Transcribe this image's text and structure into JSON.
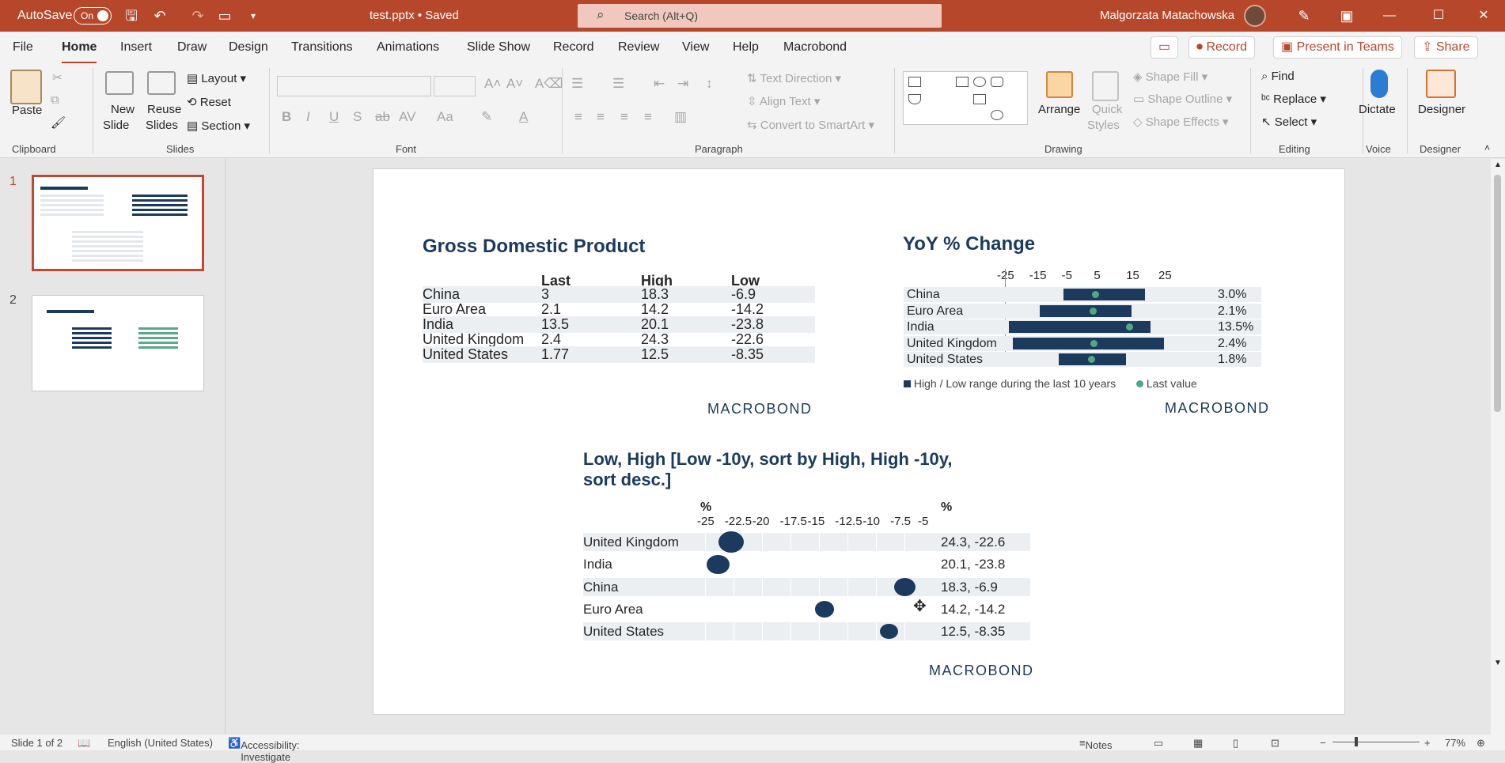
{
  "titlebar": {
    "autosave_label": "AutoSave",
    "toggle_label": "On",
    "doc_title": "test.pptx • Saved",
    "search_placeholder": "Search (Alt+Q)",
    "user_name": "Malgorzata Matachowska",
    "accent_color": "#b7472a"
  },
  "menu": {
    "items": [
      "File",
      "Home",
      "Insert",
      "Draw",
      "Design",
      "Transitions",
      "Animations",
      "Slide Show",
      "Record",
      "Review",
      "View",
      "Help",
      "Macrobond"
    ],
    "active": "Home",
    "record_button": "Record",
    "present_button": "Present in Teams",
    "share_button": "Share"
  },
  "ribbon": {
    "clipboard": {
      "paste": "Paste",
      "group": "Clipboard"
    },
    "slides": {
      "new_slide_1": "New",
      "new_slide_2": "Slide",
      "reuse_1": "Reuse",
      "reuse_2": "Slides",
      "layout": "Layout",
      "reset": "Reset",
      "section": "Section",
      "group": "Slides"
    },
    "font": {
      "group": "Font"
    },
    "paragraph": {
      "text_direction": "Text Direction",
      "align_text": "Align Text",
      "convert_smartart": "Convert to SmartArt",
      "group": "Paragraph"
    },
    "drawing": {
      "arrange": "Arrange",
      "quick_1": "Quick",
      "quick_2": "Styles",
      "shape_fill": "Shape Fill",
      "shape_outline": "Shape Outline",
      "shape_effects": "Shape Effects",
      "group": "Drawing"
    },
    "editing": {
      "find": "Find",
      "replace": "Replace",
      "select": "Select",
      "group": "Editing"
    },
    "voice": {
      "dictate": "Dictate",
      "group": "Voice"
    },
    "designer": {
      "designer": "Designer",
      "group": "Designer"
    }
  },
  "thumbnails": [
    {
      "num": "1",
      "selected": true
    },
    {
      "num": "2",
      "selected": false
    }
  ],
  "slide": {
    "gdp": {
      "title": "Gross Domestic Product",
      "headers": [
        "Last",
        "High",
        "Low"
      ],
      "rows": [
        {
          "name": "China",
          "last": "3",
          "high": "18.3",
          "low": "-6.9"
        },
        {
          "name": "Euro Area",
          "last": "2.1",
          "high": "14.2",
          "low": "-14.2"
        },
        {
          "name": "India",
          "last": "13.5",
          "high": "20.1",
          "low": "-23.8"
        },
        {
          "name": "United Kingdom",
          "last": "2.4",
          "high": "24.3",
          "low": "-22.6"
        },
        {
          "name": "United States",
          "last": "1.77",
          "high": "12.5",
          "low": "-8.35"
        }
      ],
      "logo": "MACROBOND"
    },
    "yoy": {
      "title": "YoY % Change",
      "axis_ticks": [
        "-25",
        "-15",
        "-5",
        "5",
        "15",
        "25"
      ],
      "legend_range": "High / Low range during the last 10 years",
      "legend_last": "Last value",
      "logo": "MACROBOND",
      "bar_color": "#1b3a5e",
      "dot_color": "#53a883"
    },
    "lowhigh": {
      "title_line1": "Low, High [Low  -10y, sort by High, High  -10y,",
      "title_line2": "sort desc.]",
      "unit_left": "%",
      "unit_right": "%",
      "axis_ticks": [
        "-25",
        "-22.5",
        "-20",
        "-17.5",
        "-15",
        "-12.5",
        "-10",
        "-7.5",
        "-5"
      ],
      "logo": "MACROBOND"
    }
  },
  "chart_data": [
    {
      "type": "bar",
      "title": "YoY % Change",
      "categories": [
        "China",
        "Euro Area",
        "India",
        "United Kingdom",
        "United States"
      ],
      "series": [
        {
          "name": "High / Low range during the last 10 years",
          "low": [
            -6.9,
            -14.2,
            -23.8,
            -22.6,
            -8.35
          ],
          "high": [
            18.3,
            14.2,
            20.1,
            24.3,
            12.5
          ]
        },
        {
          "name": "Last value",
          "values": [
            3.0,
            2.1,
            13.5,
            2.4,
            1.8
          ]
        }
      ],
      "value_labels": [
        "3.0%",
        "2.1%",
        "13.5%",
        "2.4%",
        "1.8%"
      ],
      "xlim": [
        -25,
        25
      ],
      "legend": "bottom"
    },
    {
      "type": "scatter",
      "title": "Low, High [Low  -10y, sort by High, High  -10y, sort desc.]",
      "categories": [
        "United Kingdom",
        "India",
        "China",
        "Euro Area",
        "United States"
      ],
      "low": [
        -22.6,
        -23.8,
        -6.9,
        -14.2,
        -8.35
      ],
      "high": [
        24.3,
        20.1,
        18.3,
        14.2,
        12.5
      ],
      "value_labels": [
        "24.3, -22.6",
        "20.1, -23.8",
        "18.3, -6.9",
        "14.2, -14.2",
        "12.5, -8.35"
      ],
      "xlim": [
        -25,
        -5
      ],
      "xlabel": "%"
    }
  ],
  "status": {
    "slide_info": "Slide 1 of 2",
    "language": "English (United States)",
    "accessibility": "Accessibility: Investigate",
    "notes": "Notes",
    "zoom": "77%"
  }
}
